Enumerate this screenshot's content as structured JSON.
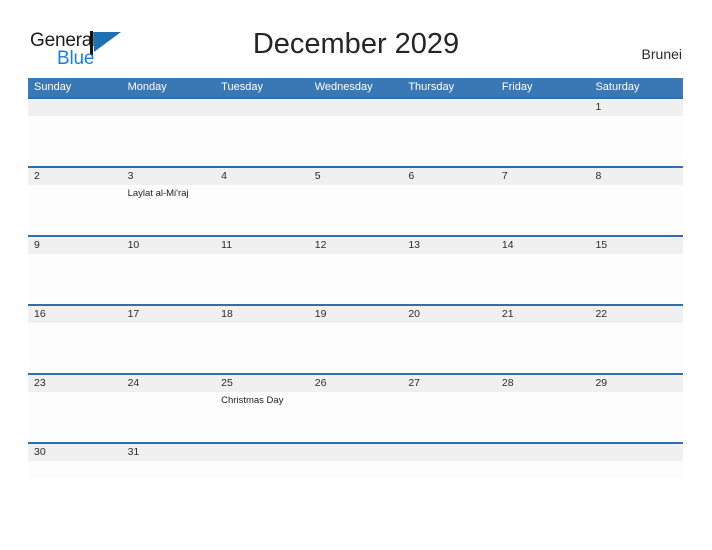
{
  "logo": {
    "text_top": "General",
    "text_bottom": "Blue",
    "flag_icon": "flag-triangle-icon",
    "color_blue": "#1c7fd6"
  },
  "header": {
    "title": "December 2029",
    "country": "Brunei"
  },
  "theme": {
    "header_blue": "#3a78b5",
    "rule_blue": "#2f6fae",
    "daynum_band": "#f0f0f0",
    "body_bg": "#fdfdfd",
    "text": "#2b2b2b"
  },
  "calendar": {
    "weekdays": [
      "Sunday",
      "Monday",
      "Tuesday",
      "Wednesday",
      "Thursday",
      "Friday",
      "Saturday"
    ],
    "weeks": [
      {
        "days": [
          {
            "num": "",
            "event": ""
          },
          {
            "num": "",
            "event": ""
          },
          {
            "num": "",
            "event": ""
          },
          {
            "num": "",
            "event": ""
          },
          {
            "num": "",
            "event": ""
          },
          {
            "num": "",
            "event": ""
          },
          {
            "num": "1",
            "event": ""
          }
        ]
      },
      {
        "days": [
          {
            "num": "2",
            "event": ""
          },
          {
            "num": "3",
            "event": "Laylat al-Mi'raj"
          },
          {
            "num": "4",
            "event": ""
          },
          {
            "num": "5",
            "event": ""
          },
          {
            "num": "6",
            "event": ""
          },
          {
            "num": "7",
            "event": ""
          },
          {
            "num": "8",
            "event": ""
          }
        ]
      },
      {
        "days": [
          {
            "num": "9",
            "event": ""
          },
          {
            "num": "10",
            "event": ""
          },
          {
            "num": "11",
            "event": ""
          },
          {
            "num": "12",
            "event": ""
          },
          {
            "num": "13",
            "event": ""
          },
          {
            "num": "14",
            "event": ""
          },
          {
            "num": "15",
            "event": ""
          }
        ]
      },
      {
        "days": [
          {
            "num": "16",
            "event": ""
          },
          {
            "num": "17",
            "event": ""
          },
          {
            "num": "18",
            "event": ""
          },
          {
            "num": "19",
            "event": ""
          },
          {
            "num": "20",
            "event": ""
          },
          {
            "num": "21",
            "event": ""
          },
          {
            "num": "22",
            "event": ""
          }
        ]
      },
      {
        "days": [
          {
            "num": "23",
            "event": ""
          },
          {
            "num": "24",
            "event": ""
          },
          {
            "num": "25",
            "event": "Christmas Day"
          },
          {
            "num": "26",
            "event": ""
          },
          {
            "num": "27",
            "event": ""
          },
          {
            "num": "28",
            "event": ""
          },
          {
            "num": "29",
            "event": ""
          }
        ]
      },
      {
        "days": [
          {
            "num": "30",
            "event": ""
          },
          {
            "num": "31",
            "event": ""
          },
          {
            "num": "",
            "event": ""
          },
          {
            "num": "",
            "event": ""
          },
          {
            "num": "",
            "event": ""
          },
          {
            "num": "",
            "event": ""
          },
          {
            "num": "",
            "event": ""
          }
        ]
      }
    ]
  }
}
